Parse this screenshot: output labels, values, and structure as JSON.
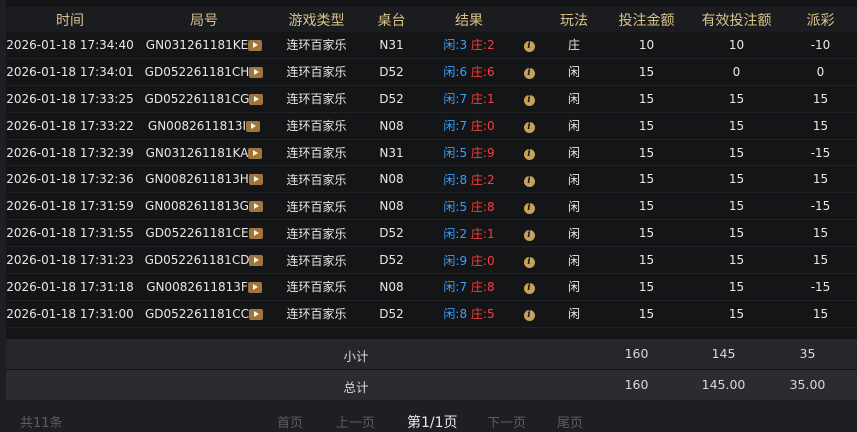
{
  "headers": [
    "时间",
    "局号",
    "游戏类型",
    "桌台",
    "结果",
    "",
    "玩法",
    "投注金额",
    "有效投注额",
    "派彩"
  ],
  "rows": [
    {
      "time": "2026-01-18 17:34:40",
      "round": "GN031261181KE",
      "game": "连环百家乐",
      "table": "N31",
      "player_label": "闲:",
      "player": "3",
      "banker_label": "庄:",
      "banker": "2",
      "mode": "庄",
      "bet": "10",
      "valid": "10",
      "payout": "-10",
      "payout_sign": "neg"
    },
    {
      "time": "2026-01-18 17:34:01",
      "round": "GD052261181CH",
      "game": "连环百家乐",
      "table": "D52",
      "player_label": "闲:",
      "player": "6",
      "banker_label": "庄:",
      "banker": "6",
      "mode": "闲",
      "bet": "15",
      "valid": "0",
      "payout": "0",
      "payout_sign": "zero"
    },
    {
      "time": "2026-01-18 17:33:25",
      "round": "GD052261181CG",
      "game": "连环百家乐",
      "table": "D52",
      "player_label": "闲:",
      "player": "7",
      "banker_label": "庄:",
      "banker": "1",
      "mode": "闲",
      "bet": "15",
      "valid": "15",
      "payout": "15",
      "payout_sign": "pos"
    },
    {
      "time": "2026-01-18 17:33:22",
      "round": "GN0082611813I",
      "game": "连环百家乐",
      "table": "N08",
      "player_label": "闲:",
      "player": "7",
      "banker_label": "庄:",
      "banker": "0",
      "mode": "闲",
      "bet": "15",
      "valid": "15",
      "payout": "15",
      "payout_sign": "pos"
    },
    {
      "time": "2026-01-18 17:32:39",
      "round": "GN031261181KA",
      "game": "连环百家乐",
      "table": "N31",
      "player_label": "闲:",
      "player": "5",
      "banker_label": "庄:",
      "banker": "9",
      "mode": "闲",
      "bet": "15",
      "valid": "15",
      "payout": "-15",
      "payout_sign": "neg"
    },
    {
      "time": "2026-01-18 17:32:36",
      "round": "GN0082611813H",
      "game": "连环百家乐",
      "table": "N08",
      "player_label": "闲:",
      "player": "8",
      "banker_label": "庄:",
      "banker": "2",
      "mode": "闲",
      "bet": "15",
      "valid": "15",
      "payout": "15",
      "payout_sign": "pos"
    },
    {
      "time": "2026-01-18 17:31:59",
      "round": "GN0082611813G",
      "game": "连环百家乐",
      "table": "N08",
      "player_label": "闲:",
      "player": "5",
      "banker_label": "庄:",
      "banker": "8",
      "mode": "闲",
      "bet": "15",
      "valid": "15",
      "payout": "-15",
      "payout_sign": "neg"
    },
    {
      "time": "2026-01-18 17:31:55",
      "round": "GD052261181CE",
      "game": "连环百家乐",
      "table": "D52",
      "player_label": "闲:",
      "player": "2",
      "banker_label": "庄:",
      "banker": "1",
      "mode": "闲",
      "bet": "15",
      "valid": "15",
      "payout": "15",
      "payout_sign": "pos"
    },
    {
      "time": "2026-01-18 17:31:23",
      "round": "GD052261181CD",
      "game": "连环百家乐",
      "table": "D52",
      "player_label": "闲:",
      "player": "9",
      "banker_label": "庄:",
      "banker": "0",
      "mode": "闲",
      "bet": "15",
      "valid": "15",
      "payout": "15",
      "payout_sign": "pos"
    },
    {
      "time": "2026-01-18 17:31:18",
      "round": "GN0082611813F",
      "game": "连环百家乐",
      "table": "N08",
      "player_label": "闲:",
      "player": "7",
      "banker_label": "庄:",
      "banker": "8",
      "mode": "闲",
      "bet": "15",
      "valid": "15",
      "payout": "-15",
      "payout_sign": "neg"
    },
    {
      "time": "2026-01-18 17:31:00",
      "round": "GD052261181CC",
      "game": "连环百家乐",
      "table": "D52",
      "player_label": "闲:",
      "player": "8",
      "banker_label": "庄:",
      "banker": "5",
      "mode": "闲",
      "bet": "15",
      "valid": "15",
      "payout": "15",
      "payout_sign": "pos"
    }
  ],
  "subtotal": {
    "label": "小计",
    "bet": "160",
    "valid": "145",
    "payout": "35"
  },
  "total": {
    "label": "总计",
    "bet": "160",
    "valid": "145.00",
    "payout": "35.00"
  },
  "pager": {
    "count": "共11条",
    "first": "首页",
    "prev": "上一页",
    "current": "第1/1页",
    "next": "下一页",
    "last": "尾页"
  },
  "colors": {
    "header_text": "#d8c28a",
    "player": "#3aa0ff",
    "banker": "#ff3c3c",
    "win": "#ff2a2a",
    "loss": "#2fb54a",
    "play_button": "#a0743a",
    "info_icon": "#c8a25a"
  },
  "icons": {
    "replay": "play-icon",
    "detail": "info-icon"
  }
}
